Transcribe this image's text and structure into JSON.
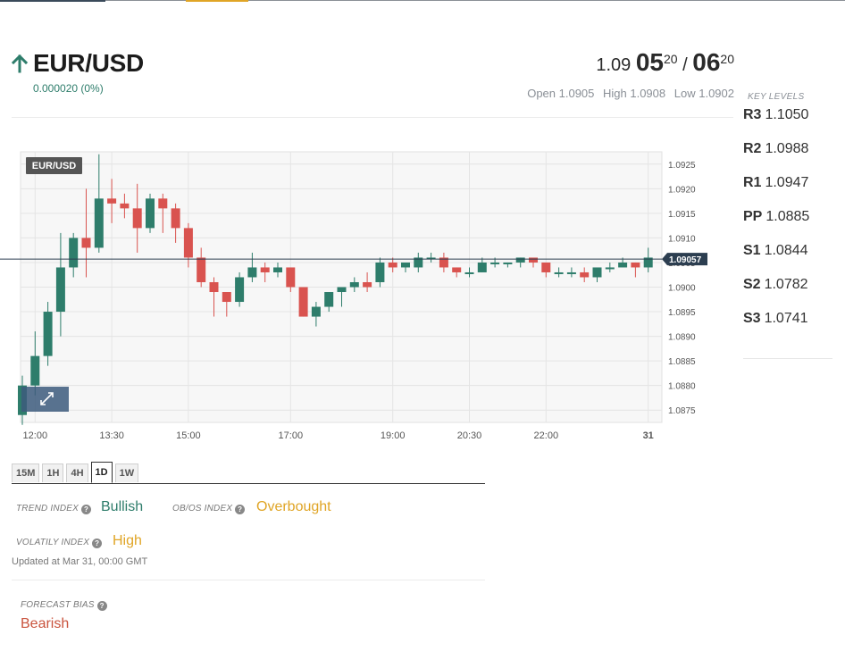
{
  "instrument": {
    "symbol": "EUR/USD",
    "change": "0.000020 (0%)",
    "bid_prefix": "1.09",
    "bid_big": "05",
    "bid_pip": "20",
    "separator": "/",
    "ask_big": "06",
    "ask_pip": "20",
    "open": "Open 1.0905",
    "high": "High 1.0908",
    "low": "Low 1.0902",
    "colors": {
      "up": "#2e7d6b",
      "down": "#d9534f",
      "accent": "#e0a526"
    }
  },
  "key_levels": {
    "title": "KEY LEVELS",
    "levels": [
      {
        "name": "R3",
        "value": "1.1050"
      },
      {
        "name": "R2",
        "value": "1.0988"
      },
      {
        "name": "R1",
        "value": "1.0947"
      },
      {
        "name": "PP",
        "value": "1.0885"
      },
      {
        "name": "S1",
        "value": "1.0844"
      },
      {
        "name": "S2",
        "value": "1.0782"
      },
      {
        "name": "S3",
        "value": "1.0741"
      }
    ]
  },
  "chart_data": {
    "type": "candlestick",
    "title": "EUR/USD",
    "current_price": 1.09057,
    "current_label": "1.09057",
    "ylim": [
      1.08725,
      1.09275
    ],
    "y_ticks": [
      "1.0875",
      "1.0880",
      "1.0885",
      "1.0890",
      "1.0895",
      "1.0900",
      "1.0905",
      "1.0910",
      "1.0915",
      "1.0920",
      "1.0925"
    ],
    "x_ticks": [
      {
        "label": "12:00",
        "slot": 1
      },
      {
        "label": "13:30",
        "slot": 7
      },
      {
        "label": "15:00",
        "slot": 13
      },
      {
        "label": "17:00",
        "slot": 21
      },
      {
        "label": "19:00",
        "slot": 29
      },
      {
        "label": "20:30",
        "slot": 35
      },
      {
        "label": "22:00",
        "slot": 41
      },
      {
        "label": "31",
        "slot": 49
      }
    ],
    "grid": true,
    "candles": [
      [
        1.0874,
        1.088,
        1.0872,
        1.0882
      ],
      [
        1.088,
        1.0886,
        1.0878,
        1.0891
      ],
      [
        1.0886,
        1.0895,
        1.0884,
        1.0897
      ],
      [
        1.0895,
        1.0904,
        1.089,
        1.0911
      ],
      [
        1.0904,
        1.091,
        1.0902,
        1.0911
      ],
      [
        1.091,
        1.0908,
        1.0902,
        1.092
      ],
      [
        1.0908,
        1.0918,
        1.0907,
        1.0927
      ],
      [
        1.0918,
        1.0917,
        1.0913,
        1.0922
      ],
      [
        1.0917,
        1.0916,
        1.0914,
        1.0919
      ],
      [
        1.0916,
        1.0912,
        1.0907,
        1.0921
      ],
      [
        1.0912,
        1.0918,
        1.0911,
        1.0919
      ],
      [
        1.0918,
        1.0916,
        1.0911,
        1.0919
      ],
      [
        1.0916,
        1.0912,
        1.0909,
        1.0917
      ],
      [
        1.0912,
        1.0906,
        1.0904,
        1.0913
      ],
      [
        1.0906,
        1.0901,
        1.09,
        1.0908
      ],
      [
        1.0901,
        1.0899,
        1.0894,
        1.0902
      ],
      [
        1.0899,
        1.0897,
        1.0894,
        1.0899
      ],
      [
        1.0897,
        1.0902,
        1.0896,
        1.0903
      ],
      [
        1.0902,
        1.0904,
        1.0901,
        1.0907
      ],
      [
        1.0904,
        1.0903,
        1.0901,
        1.0905
      ],
      [
        1.0903,
        1.0904,
        1.0902,
        1.0905
      ],
      [
        1.0904,
        1.09,
        1.0899,
        1.0904
      ],
      [
        1.09,
        1.0894,
        1.0894,
        1.09
      ],
      [
        1.0894,
        1.0896,
        1.0892,
        1.0897
      ],
      [
        1.0896,
        1.0899,
        1.0895,
        1.0899
      ],
      [
        1.0899,
        1.09,
        1.0896,
        1.09
      ],
      [
        1.09,
        1.0901,
        1.0899,
        1.0902
      ],
      [
        1.0901,
        1.09,
        1.0899,
        1.0903
      ],
      [
        1.0901,
        1.0905,
        1.09,
        1.0906
      ],
      [
        1.0905,
        1.0904,
        1.0903,
        1.0906
      ],
      [
        1.0904,
        1.0905,
        1.0903,
        1.0905
      ],
      [
        1.0904,
        1.0906,
        1.0903,
        1.0907
      ],
      [
        1.0906,
        1.0906,
        1.0905,
        1.0907
      ],
      [
        1.0906,
        1.0904,
        1.0903,
        1.0907
      ],
      [
        1.0904,
        1.0903,
        1.0902,
        1.0904
      ],
      [
        1.0903,
        1.0903,
        1.0902,
        1.0904
      ],
      [
        1.0903,
        1.0905,
        1.0903,
        1.0906
      ],
      [
        1.0905,
        1.0905,
        1.0904,
        1.0906
      ],
      [
        1.0905,
        1.0905,
        1.0904,
        1.0905
      ],
      [
        1.0905,
        1.0906,
        1.0904,
        1.0906
      ],
      [
        1.0906,
        1.0905,
        1.0904,
        1.0906
      ],
      [
        1.0905,
        1.0903,
        1.0902,
        1.0905
      ],
      [
        1.0903,
        1.0903,
        1.0902,
        1.0904
      ],
      [
        1.0903,
        1.0903,
        1.0902,
        1.0904
      ],
      [
        1.0903,
        1.0902,
        1.0901,
        1.0904
      ],
      [
        1.0902,
        1.0904,
        1.0901,
        1.0904
      ],
      [
        1.0904,
        1.0904,
        1.0903,
        1.0905
      ],
      [
        1.0904,
        1.0905,
        1.0904,
        1.0906
      ],
      [
        1.0905,
        1.0904,
        1.0902,
        1.0905
      ],
      [
        1.0904,
        1.0906,
        1.0903,
        1.0908
      ]
    ]
  },
  "timeframes": {
    "items": [
      "15M",
      "1H",
      "4H",
      "1D",
      "1W"
    ],
    "active": "1D"
  },
  "indices": {
    "trend_label": "TREND INDEX",
    "trend_value": "Bullish",
    "obos_label": "OB/OS INDEX",
    "obos_value": "Overbought",
    "volatility_label": "VOLATILY INDEX",
    "volatility_value": "High",
    "updated": "Updated at Mar 31, 00:00 GMT",
    "bias_label": "FORECAST BIAS",
    "bias_value": "Bearish",
    "colors": {
      "bullish": "#2e7d6b",
      "warning": "#e0a526",
      "bearish": "#c9533d"
    }
  }
}
